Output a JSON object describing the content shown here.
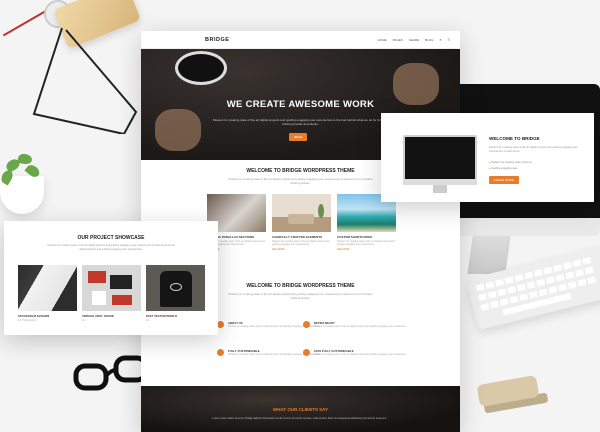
{
  "site": {
    "logo": "BRIDGE",
    "menu": [
      "HOME",
      "PAGES",
      "SHARE",
      "BLOG"
    ],
    "hero": {
      "title": "WE CREATE AWESOME WORK",
      "subtitle": "Passion for creating state of the art digital projects and guiding engaging user experiences is the fuel behind what we do for forward-thinking brands and clients.",
      "button": "READ"
    },
    "welcome": {
      "title": "WELCOME TO BRIDGE WORDPRESS THEME",
      "text": "Passion for creating state of the art digital projects and guiding engaging user experiences is what we do for forward-thinking brands.",
      "cards": [
        {
          "title": "AMAZING PARALLAX SECTIONS",
          "text": "Passion for creating state of the art digital projects and guiding engaging user experiences.",
          "more": "SEE MORE"
        },
        {
          "title": "CAREFULLY CRAFTED ELEMENTS",
          "text": "Passion for creating state of the art digital projects and guiding engaging user experiences.",
          "more": "SEE MORE"
        },
        {
          "title": "CUSTOM SHORTCODES",
          "text": "Passion for creating state of the art digital projects and guiding engaging user experiences.",
          "more": "SEE MORE"
        }
      ]
    },
    "welcome2": {
      "title": "WELCOME TO BRIDGE WORDPRESS THEME",
      "text": "Passion for creating state of the art digital projects and guiding engaging user experiences is what we do for forward-thinking brands.",
      "features": [
        {
          "title": "ABOUT US",
          "text": "Passion for creating state of the art digital projects and guiding engaging user experiences."
        },
        {
          "title": "RETINA READY",
          "text": "Passion for creating state of the art digital projects and guiding engaging user experiences."
        },
        {
          "title": "FULLY CUSTOMIZABLE",
          "text": "Passion for creating state of the art digital projects and guiding engaging user experiences."
        },
        {
          "title": "100% FULLY CUSTOMIZABLE",
          "text": "Passion for creating state of the art digital projects and guiding engaging user experiences."
        }
      ]
    },
    "clients": {
      "title": "WHAT OUR CLIENTS SAY",
      "quote": "Lorem ipsum dolor sit amet, Bridge dellluvu Dominator et elit et enim ad minim veniam, nulla tempor dolor emmetquiusa adipisicing elit sed do eiusmod ..."
    }
  },
  "right_card": {
    "title": "WELCOME TO BRIDGE",
    "text": "Passion for creating state of the art digital projects and guiding engaging user experiences is what we do.",
    "items": [
      "Passion for creating state of the art",
      "Guiding engaging user"
    ],
    "button": "LEARN MORE"
  },
  "left_card": {
    "title": "OUR PROJECT SHOWCASE",
    "text": "Passion for creating state of the art digital projects and guiding engaging user experiences is what we do for all digital projects and guiding engaging user experiences.",
    "projects": [
      {
        "title": "STOCKHOLM FASHION",
        "category": "Art, Photography"
      },
      {
        "title": "VINTAGE VINYL HOUSE",
        "category": "Art"
      },
      {
        "title": "PAST VECTOR WORLD",
        "category": "Art"
      }
    ]
  },
  "colors": {
    "accent": "#e97b2d",
    "dark": "#1c1917"
  }
}
